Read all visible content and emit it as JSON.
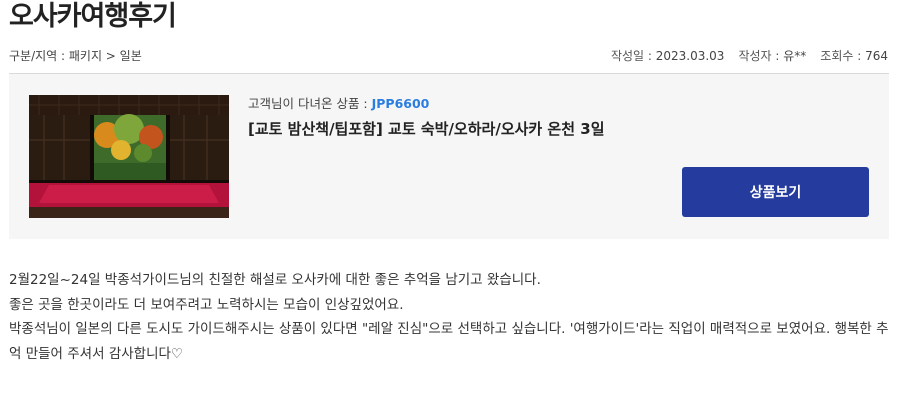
{
  "page": {
    "title": "오사카여행후기"
  },
  "meta": {
    "category": "구분/지역 : 패키지 > 일본",
    "date_label": "작성일 : ",
    "date": "2023.03.03",
    "author_label": "작성자 : ",
    "author": "유**",
    "views_label": "조회수 : ",
    "views": "764"
  },
  "product": {
    "guest_prefix": "고객님이 다녀온 상품 : ",
    "code": "JPP6600",
    "name": "[교토 밤산책/팁포함] 교토 숙박/오하라/오사카 온천 3일",
    "view_button": "상품보기",
    "thumbnail_icon": "temple-garden-photo"
  },
  "review": {
    "lines": [
      "2월22일~24일 박종석가이드님의 친절한 해설로 오사카에 대한 좋은 추억을 남기고 왔습니다.",
      "좋은 곳을 한곳이라도 더 보여주려고 노력하시는 모습이 인상깊었어요.",
      "박종석님이 일본의 다른 도시도 가이드해주시는 상품이 있다면 \"레알 진심\"으로 선택하고 싶습니다. '여행가이드'라는 직업이 매력적으로 보였어요. 행복한 추억 만들어 주셔서 감사합니다♡"
    ]
  },
  "colors": {
    "accent_blue": "#2a7de1",
    "button_bg": "#253b9e",
    "box_bg": "#f6f6f6"
  }
}
